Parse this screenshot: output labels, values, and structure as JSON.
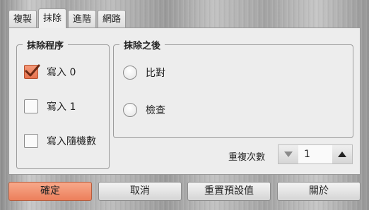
{
  "tabs": [
    {
      "label": "複製"
    },
    {
      "label": "抹除"
    },
    {
      "label": "進階"
    },
    {
      "label": "網路"
    }
  ],
  "erase_procedure": {
    "title": "抹除程序",
    "options": [
      {
        "label": "寫入 0",
        "checked": true
      },
      {
        "label": "寫入 1",
        "checked": false
      },
      {
        "label": "寫入隨機數",
        "checked": false
      }
    ]
  },
  "after_erase": {
    "title": "抹除之後",
    "options": [
      {
        "label": "比對",
        "selected": false
      },
      {
        "label": "檢查",
        "selected": false
      }
    ]
  },
  "repeat": {
    "label": "重複次數",
    "value": "1"
  },
  "buttons": {
    "ok": "確定",
    "cancel": "取消",
    "reset": "重置預設值",
    "about": "關於"
  },
  "colors": {
    "accent": "#ec7f5b"
  }
}
